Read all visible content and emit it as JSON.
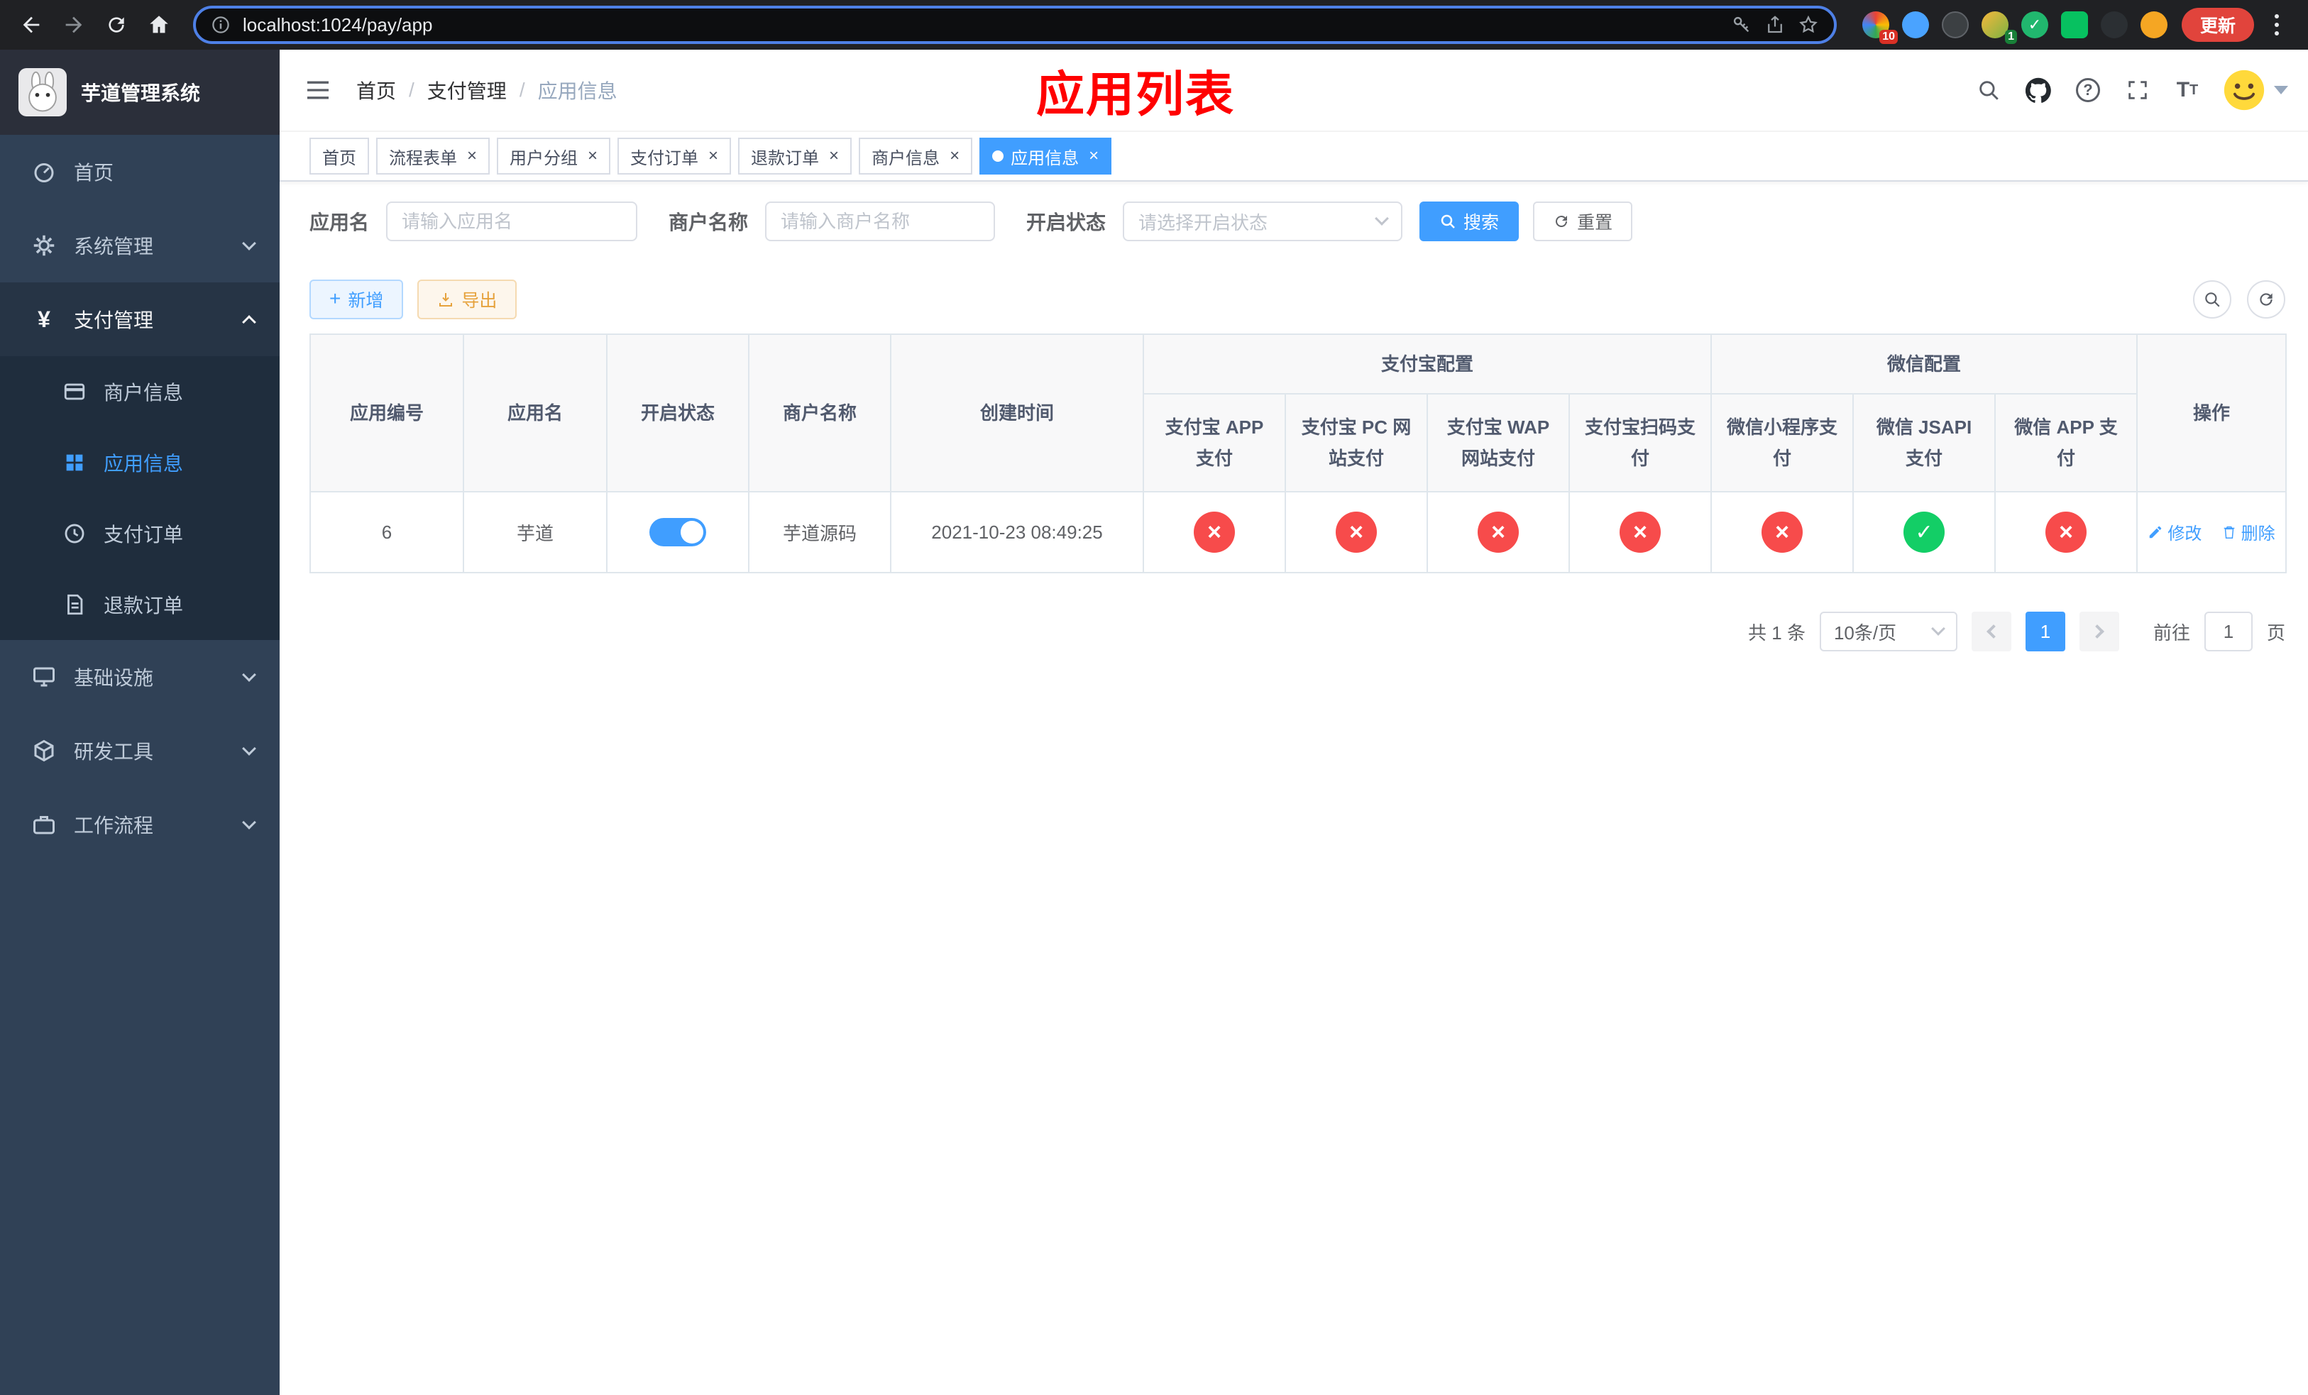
{
  "browser": {
    "url": "localhost:1024/pay/app",
    "update_label": "更新",
    "extension_badge_1": "10",
    "extension_badge_2": "1"
  },
  "sidebar": {
    "title": "芋道管理系统",
    "menu": [
      {
        "label": "首页",
        "icon": "dashboard-icon"
      },
      {
        "label": "系统管理",
        "icon": "gear-icon"
      },
      {
        "label": "支付管理",
        "icon": "yen-icon"
      },
      {
        "label": "商户信息",
        "icon": "card-icon"
      },
      {
        "label": "应用信息",
        "icon": "grid-icon"
      },
      {
        "label": "支付订单",
        "icon": "clock-icon"
      },
      {
        "label": "退款订单",
        "icon": "document-icon"
      },
      {
        "label": "基础设施",
        "icon": "monitor-icon"
      },
      {
        "label": "研发工具",
        "icon": "cube-icon"
      },
      {
        "label": "工作流程",
        "icon": "briefcase-icon"
      }
    ]
  },
  "header": {
    "breadcrumb": [
      "首页",
      "支付管理",
      "应用信息"
    ],
    "annotation": "应用列表"
  },
  "tabs": [
    {
      "label": "首页",
      "closable": false,
      "active": false
    },
    {
      "label": "流程表单",
      "closable": true,
      "active": false
    },
    {
      "label": "用户分组",
      "closable": true,
      "active": false
    },
    {
      "label": "支付订单",
      "closable": true,
      "active": false
    },
    {
      "label": "退款订单",
      "closable": true,
      "active": false
    },
    {
      "label": "商户信息",
      "closable": true,
      "active": false
    },
    {
      "label": "应用信息",
      "closable": true,
      "active": true
    }
  ],
  "filter": {
    "app_name_label": "应用名",
    "app_name_placeholder": "请输入应用名",
    "merchant_label": "商户名称",
    "merchant_placeholder": "请输入商户名称",
    "status_label": "开启状态",
    "status_placeholder": "请选择开启状态",
    "search_label": "搜索",
    "reset_label": "重置"
  },
  "toolbar": {
    "add_label": "新增",
    "export_label": "导出"
  },
  "table": {
    "columns": {
      "app_id": "应用编号",
      "app_name": "应用名",
      "status": "开启状态",
      "merchant": "商户名称",
      "created": "创建时间",
      "alipay_group": "支付宝配置",
      "alipay_app": "支付宝 APP 支付",
      "alipay_pc": "支付宝 PC 网站支付",
      "alipay_wap": "支付宝 WAP 网站支付",
      "alipay_qr": "支付宝扫码支付",
      "wechat_group": "微信配置",
      "wechat_mini": "微信小程序支付",
      "wechat_jsapi": "微信 JSAPI 支付",
      "wechat_app": "微信 APP 支付",
      "actions": "操作"
    },
    "rows": [
      {
        "app_id": "6",
        "app_name": "芋道",
        "status_on": true,
        "merchant": "芋道源码",
        "created": "2021-10-23 08:49:25",
        "configs": [
          false,
          false,
          false,
          false,
          false,
          true,
          false
        ],
        "edit_label": "修改",
        "delete_label": "删除"
      }
    ]
  },
  "pagination": {
    "total": "共 1 条",
    "page_size": "10条/页",
    "current_page": "1",
    "goto_label": "前往",
    "goto_value": "1",
    "goto_unit": "页"
  },
  "colors": {
    "accent": "#409eff",
    "danger": "#f74b4b",
    "success": "#13ce66",
    "sidebar_bg": "#304156",
    "submenu_bg": "#1f2d3d",
    "annotation_red": "#ff0000",
    "chrome_bg": "#202124",
    "update_button_bg": "#e1443c"
  },
  "icons": {
    "close": "×",
    "check": "✓",
    "cross": "×",
    "currency": "¥",
    "help": "?"
  }
}
